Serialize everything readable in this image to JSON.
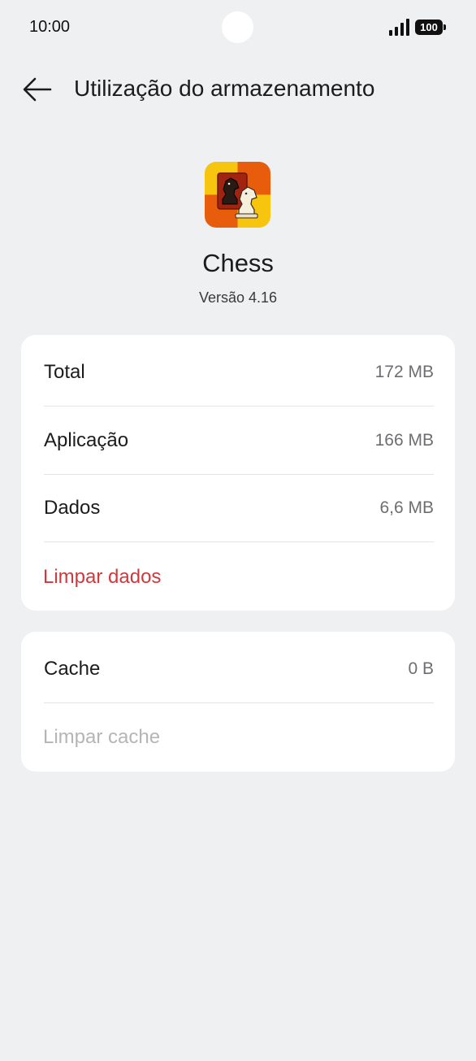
{
  "status_bar": {
    "time": "10:00",
    "battery": "100"
  },
  "header": {
    "title": "Utilização do armazenamento",
    "back_icon": "arrow-left-icon"
  },
  "app": {
    "name": "Chess",
    "version": "Versão 4.16",
    "icon": "chess-knight-app-icon"
  },
  "storage": {
    "rows": [
      {
        "label": "Total",
        "value": "172 MB"
      },
      {
        "label": "Aplicação",
        "value": "166 MB"
      },
      {
        "label": "Dados",
        "value": "6,6 MB"
      }
    ],
    "clear_data_label": "Limpar dados"
  },
  "cache": {
    "label": "Cache",
    "value": "0 B",
    "clear_cache_label": "Limpar cache"
  },
  "colors": {
    "background": "#eff0f2",
    "card": "#ffffff",
    "danger": "#d0393c",
    "disabled": "#b5b5b8"
  }
}
